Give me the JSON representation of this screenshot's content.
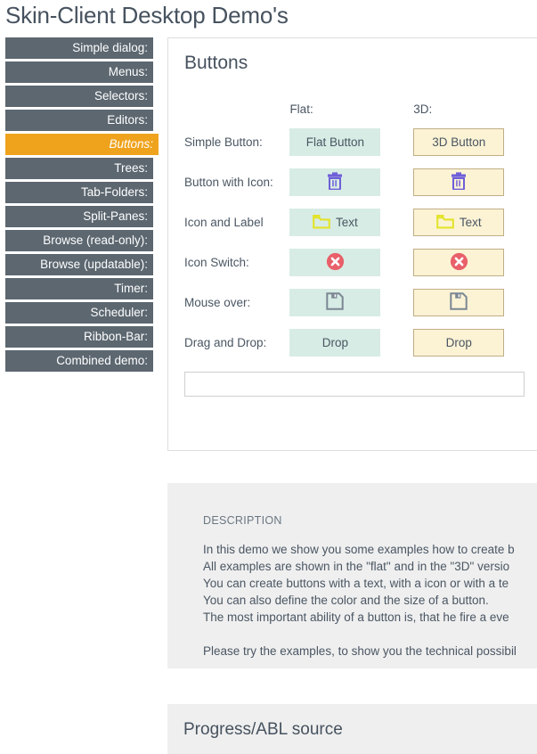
{
  "page": {
    "title": "Skin-Client Desktop Demo's"
  },
  "sidebar": {
    "items": [
      {
        "label": "Simple dialog:",
        "active": false
      },
      {
        "label": "Menus:",
        "active": false
      },
      {
        "label": "Selectors:",
        "active": false
      },
      {
        "label": "Editors:",
        "active": false
      },
      {
        "label": "Buttons:",
        "active": true
      },
      {
        "label": "Trees:",
        "active": false
      },
      {
        "label": "Tab-Folders:",
        "active": false
      },
      {
        "label": "Split-Panes:",
        "active": false
      },
      {
        "label": "Browse (read-only):",
        "active": false
      },
      {
        "label": "Browse (updatable):",
        "active": false
      },
      {
        "label": "Timer:",
        "active": false
      },
      {
        "label": "Scheduler:",
        "active": false
      },
      {
        "label": "Ribbon-Bar:",
        "active": false
      },
      {
        "label": "Combined demo:",
        "active": false
      }
    ]
  },
  "card": {
    "title": "Buttons",
    "columns": {
      "flat": "Flat:",
      "three_d": "3D:"
    },
    "rows": [
      {
        "label": "Simple Button:",
        "flat": {
          "text": "Flat Button",
          "icon": null
        },
        "three_d": {
          "text": "3D Button",
          "icon": null
        }
      },
      {
        "label": "Button with Icon:",
        "flat": {
          "text": "",
          "icon": "trash-icon"
        },
        "three_d": {
          "text": "",
          "icon": "trash-icon"
        }
      },
      {
        "label": "Icon and Label",
        "flat": {
          "text": "Text",
          "icon": "folder-icon"
        },
        "three_d": {
          "text": "Text",
          "icon": "folder-icon"
        }
      },
      {
        "label": "Icon Switch:",
        "flat": {
          "text": "",
          "icon": "cancel-circle-icon"
        },
        "three_d": {
          "text": "",
          "icon": "cancel-circle-icon"
        }
      },
      {
        "label": "Mouse over:",
        "flat": {
          "text": "",
          "icon": "save-icon"
        },
        "three_d": {
          "text": "",
          "icon": "save-icon"
        }
      },
      {
        "label": "Drag and Drop:",
        "flat": {
          "text": "Drop",
          "icon": null
        },
        "three_d": {
          "text": "Drop",
          "icon": null
        }
      }
    ],
    "drop_input": {
      "value": "",
      "placeholder": ""
    }
  },
  "description": {
    "heading": "DESCRIPTION",
    "text": "In this demo we show you some examples how to create b\nAll examples are shown in the \"flat\" and in the \"3D\" versio\nYou can create buttons with a text, with a icon or with a te\nYou can also define the color and the size of a button.\nThe most important ability of a button is, that he fire a eve\n\nPlease try the examples, to show you the technical possibil"
  },
  "source": {
    "title": "Progress/ABL source"
  },
  "colors": {
    "sidebar_bg": "#5c6770",
    "sidebar_active": "#efa31d",
    "flat_button": "#d7ece4",
    "three_d_button": "#fcf3d5",
    "three_d_border": "#c0ad85",
    "panel_bg": "#efefef",
    "text": "#4a5663",
    "trash_icon": "#6f5fd8",
    "folder_icon": "#e3e32a",
    "cancel_icon": "#e8606a",
    "save_icon": "#7b8793"
  }
}
